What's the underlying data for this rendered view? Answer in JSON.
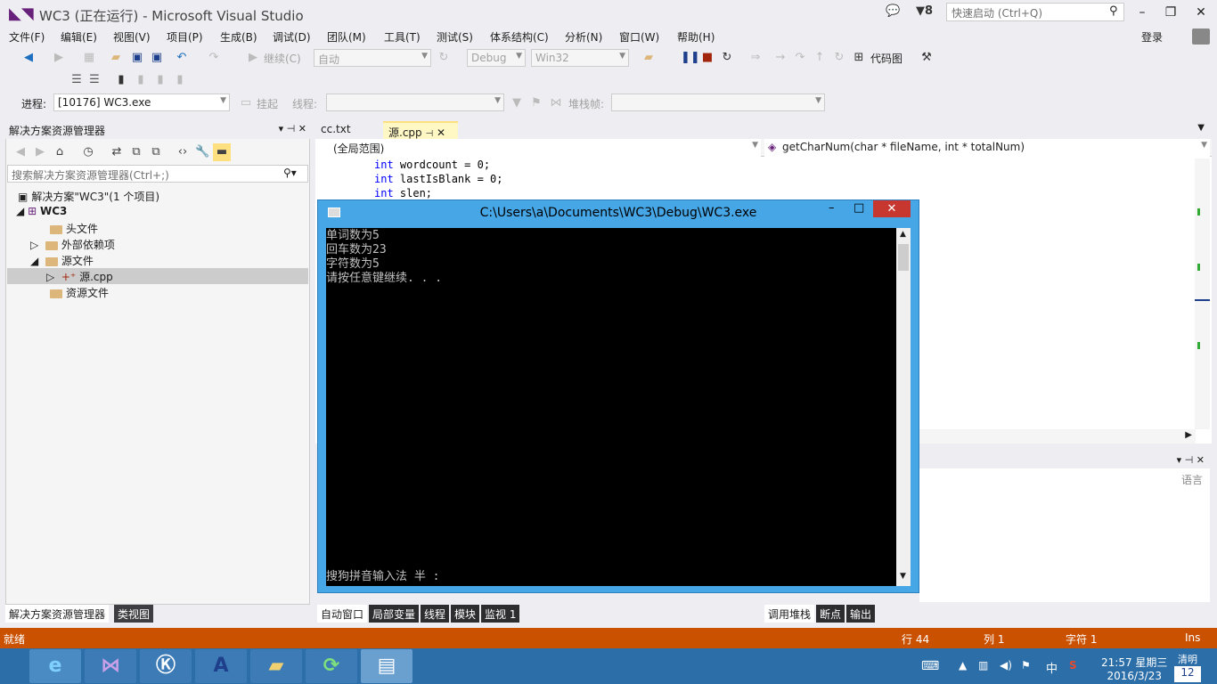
{
  "window": {
    "title": "WC3 (正在运行) - Microsoft Visual Studio",
    "notifications": "8",
    "quick_launch_placeholder": "快速启动 (Ctrl+Q)",
    "login": "登录"
  },
  "menu": [
    "文件(F)",
    "编辑(E)",
    "视图(V)",
    "项目(P)",
    "生成(B)",
    "调试(D)",
    "团队(M)",
    "工具(T)",
    "测试(S)",
    "体系结构(C)",
    "分析(N)",
    "窗口(W)",
    "帮助(H)"
  ],
  "toolbar": {
    "continue": "继续(C)",
    "auto": "自动",
    "config": "Debug",
    "platform": "Win32",
    "codemap": "代码图"
  },
  "debugbar": {
    "process_label": "进程:",
    "process_value": "[10176] WC3.exe",
    "suspend": "挂起",
    "thread_label": "线程:",
    "stackframe_label": "堆栈帧:"
  },
  "solution_explorer": {
    "title": "解决方案资源管理器",
    "search_placeholder": "搜索解决方案资源管理器(Ctrl+;)",
    "solution": "解决方案\"WC3\"(1 个项目)",
    "project": "WC3",
    "items": [
      "头文件",
      "外部依赖项",
      "源文件",
      "源.cpp",
      "资源文件"
    ]
  },
  "left_tabs": [
    "解决方案资源管理器",
    "类视图"
  ],
  "editor": {
    "tabs": [
      "cc.txt",
      "源.cpp"
    ],
    "scope": "(全局范围)",
    "function": "getCharNum(char * fileName, int * totalNum)",
    "code_lines": [
      {
        "kw": "int",
        "rest": " wordcount = 0;"
      },
      {
        "kw": "int",
        "rest": " lastIsBlank = 0;"
      },
      {
        "kw": "int",
        "rest": " slen;"
      }
    ]
  },
  "console": {
    "title": "C:\\Users\\a\\Documents\\WC3\\Debug\\WC3.exe",
    "lines": [
      "单词数为5",
      "回车数为23",
      "字符数为5",
      "请按任意键继续. . ."
    ],
    "ime": "搜狗拼音输入法 半 :"
  },
  "right_panel": {
    "column": "语言"
  },
  "bottom_tabs_mid": [
    "自动窗口",
    "局部变量",
    "线程",
    "模块",
    "监视 1"
  ],
  "bottom_tabs_right": [
    "调用堆栈",
    "断点",
    "输出"
  ],
  "status": {
    "text": "就绪",
    "line": "行 44",
    "col": "列 1",
    "char": "字符 1",
    "mode": "Ins"
  },
  "taskbar": {
    "time": "21:57 星期三",
    "date": "2016/3/23",
    "ime": "中",
    "weather": "清明",
    "day": "12"
  }
}
